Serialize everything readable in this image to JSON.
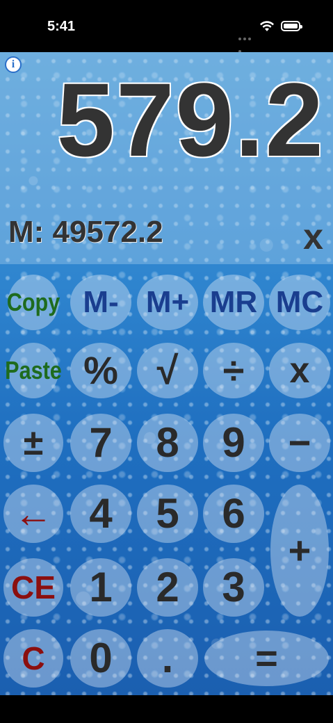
{
  "status_bar": {
    "time": "5:41"
  },
  "display": {
    "info_label": "i",
    "value": "579.2",
    "memory": "M: 49572.2",
    "operator": "x"
  },
  "keys": {
    "copy": "Copy",
    "m_minus": "M-",
    "m_plus": "M+",
    "mr": "MR",
    "mc": "MC",
    "paste": "Paste",
    "percent": "%",
    "sqrt": "√",
    "divide": "÷",
    "multiply": "x",
    "plus_minus": "±",
    "seven": "7",
    "eight": "8",
    "nine": "9",
    "minus": "−",
    "backspace": "←",
    "four": "4",
    "five": "5",
    "six": "6",
    "plus": "+",
    "ce": "CE",
    "one": "1",
    "two": "2",
    "three": "3",
    "clear": "C",
    "zero": "0",
    "decimal": ".",
    "equals": "="
  },
  "colors": {
    "memory_keys": "#1a3e8f",
    "clipboard_keys": "#1e6b1e",
    "clear_keys": "#8b0f0f",
    "digit_keys": "#2a2a2a",
    "background": "#2f85cf"
  }
}
